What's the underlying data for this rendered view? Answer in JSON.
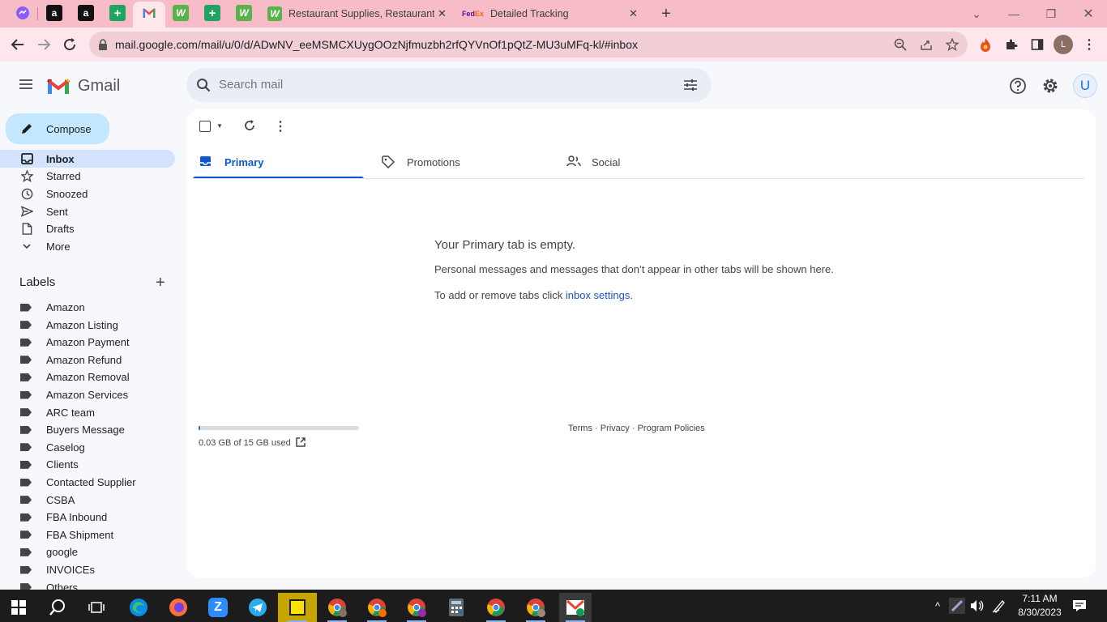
{
  "browser": {
    "tabs": [
      {
        "title": "Restaurant Supplies, Restaurant S",
        "icon": "webstaurant-icon"
      },
      {
        "title": "Detailed Tracking",
        "icon": "fedex-icon"
      }
    ],
    "new_tab": "+",
    "url": "mail.google.com/mail/u/0/d/ADwNV_eeMSMCXUygOOzNjfmuzbh2rfQYVnOf1pQtZ-MU3uMFq-kl/#inbox",
    "profile_initial": "L"
  },
  "gmail": {
    "brand": "Gmail",
    "search_placeholder": "Search mail",
    "account_initial": "U",
    "compose_label": "Compose",
    "nav": [
      {
        "label": "Inbox",
        "icon": "inbox-icon",
        "active": true
      },
      {
        "label": "Starred",
        "icon": "star-icon"
      },
      {
        "label": "Snoozed",
        "icon": "clock-icon"
      },
      {
        "label": "Sent",
        "icon": "send-icon"
      },
      {
        "label": "Drafts",
        "icon": "draft-icon"
      },
      {
        "label": "More",
        "icon": "chevron-down-icon"
      }
    ],
    "labels_heading": "Labels",
    "labels": [
      "Amazon",
      "Amazon Listing",
      "Amazon Payment",
      "Amazon Refund",
      "Amazon Removal",
      "Amazon Services",
      "ARC team",
      "Buyers Message",
      "Caselog",
      "Clients",
      "Contacted Supplier",
      "CSBA",
      "FBA Inbound",
      "FBA Shipment",
      "google",
      "INVOICEs",
      "Others"
    ],
    "tabs": [
      {
        "label": "Primary",
        "active": true
      },
      {
        "label": "Promotions"
      },
      {
        "label": "Social"
      }
    ],
    "empty_title": "Your Primary tab is empty.",
    "empty_desc": "Personal messages and messages that don’t appear in other tabs will be shown here.",
    "empty_settings_prefix": "To add or remove tabs click ",
    "empty_settings_link": "inbox settings",
    "empty_settings_suffix": ".",
    "storage_text": "0.03 GB of 15 GB used",
    "storage_fraction": 0.002,
    "footer_links": [
      "Terms",
      "Privacy",
      "Program Policies"
    ],
    "footer_sep": " · "
  },
  "taskbar": {
    "time": "7:11 AM",
    "date": "8/30/2023"
  },
  "colors": {
    "tab_strip": "#f8bcc8",
    "toolbar": "#fde7ec",
    "compose": "#c2e7ff",
    "active_nav": "#d3e3fd",
    "primary_accent": "#0b57d0",
    "taskbar": "#1c1c1c"
  }
}
